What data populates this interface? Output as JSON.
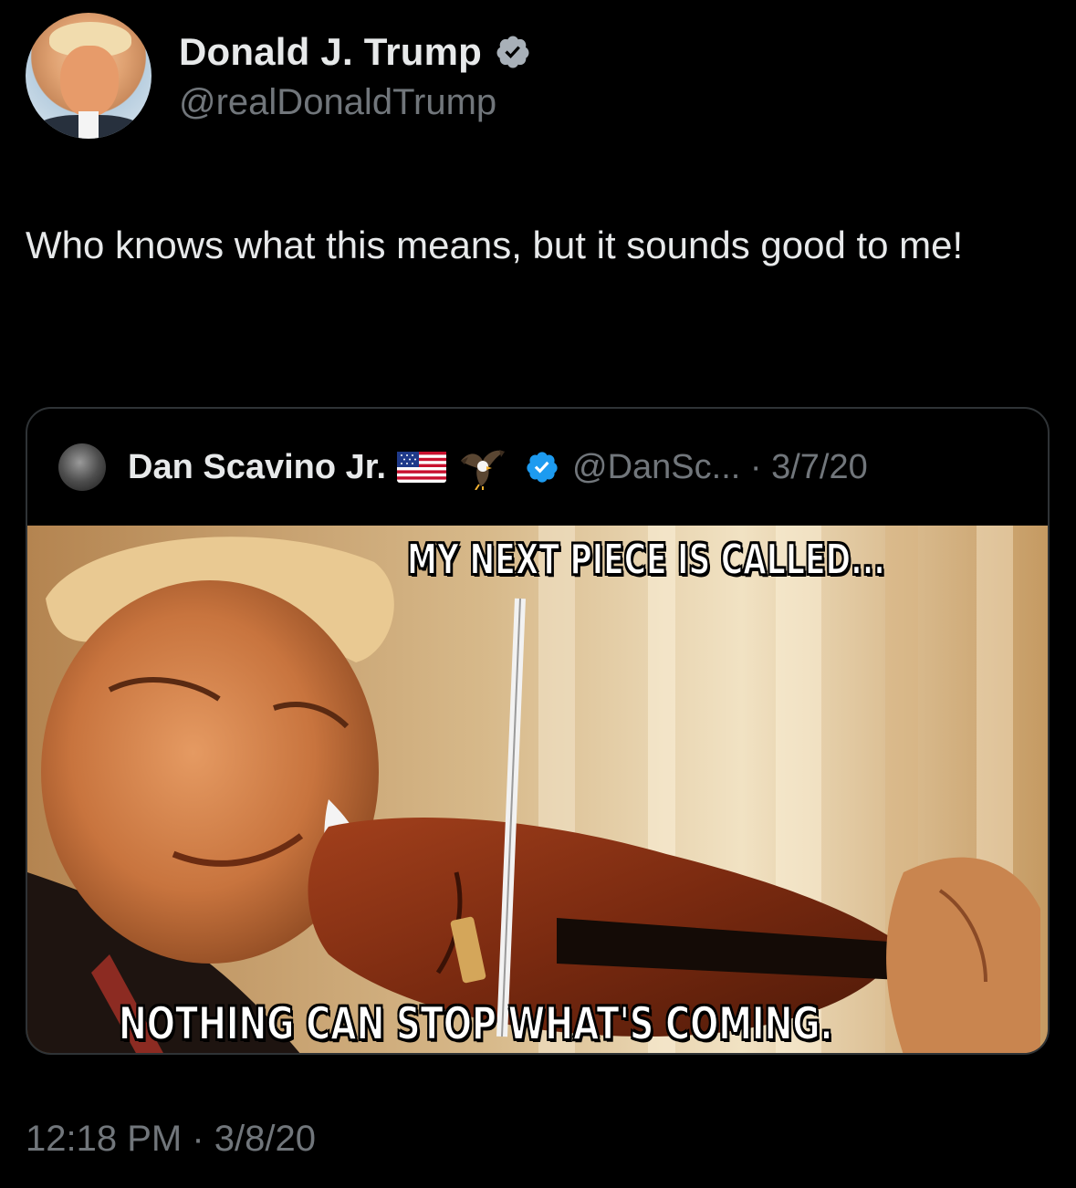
{
  "tweet": {
    "author": {
      "display_name": "Donald J. Trump",
      "handle": "@realDonaldTrump",
      "verified": true,
      "avatar_icon": "profile-photo"
    },
    "text": "Who knows what this means, but it sounds good to me!",
    "timestamp": "12:18 PM · 3/8/20"
  },
  "quote": {
    "author": {
      "display_name": "Dan Scavino Jr.",
      "emoji": [
        "us-flag-icon",
        "eagle-icon"
      ],
      "verified": true,
      "meta": "@DanSc... · 3/7/20"
    },
    "media": {
      "caption_top": "MY NEXT PIECE IS CALLED...",
      "caption_bottom": "NOTHING CAN STOP WHAT'S COMING."
    }
  },
  "colors": {
    "background": "#000000",
    "text_primary": "#e7e9ea",
    "text_secondary": "#71767b",
    "border": "#2f3336",
    "verified_badge_main": "#a8b0b8",
    "verified_badge_quote": "#1d9bf0"
  }
}
